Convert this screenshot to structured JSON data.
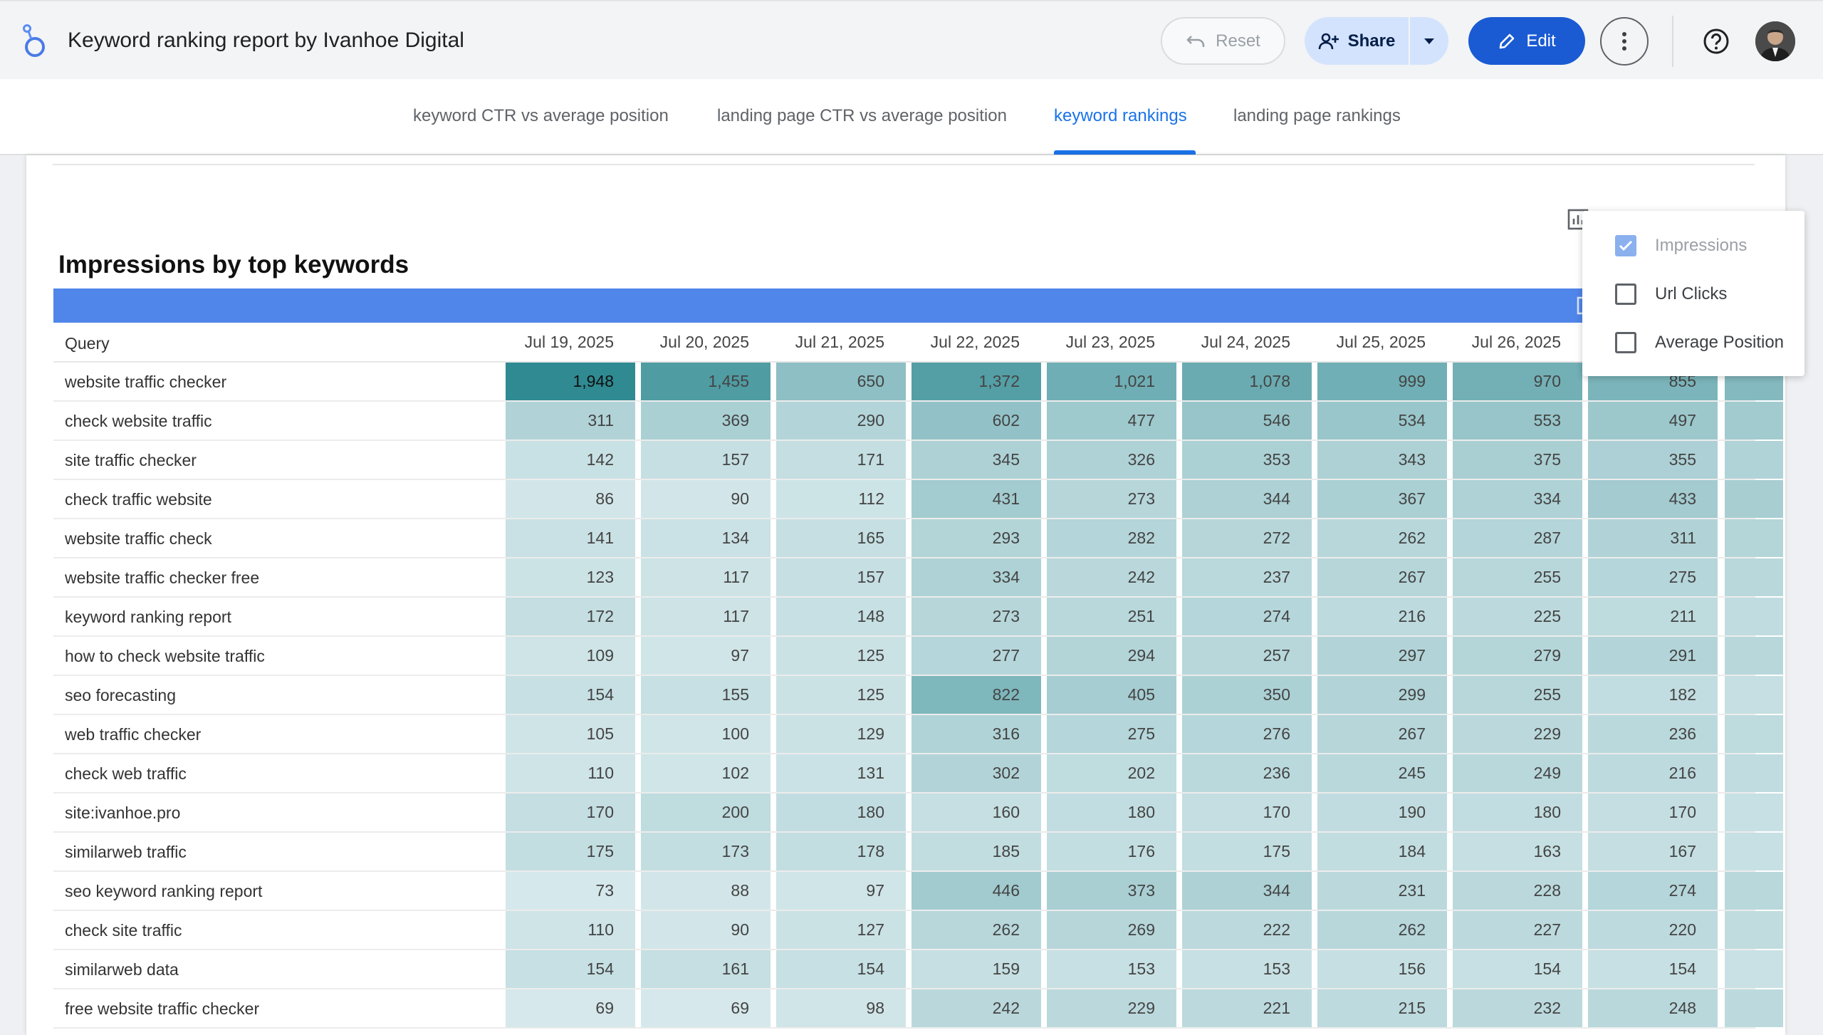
{
  "app": {
    "title": "Keyword ranking report by Ivanhoe Digital"
  },
  "toolbar": {
    "reset_label": "Reset",
    "share_label": "Share",
    "edit_label": "Edit"
  },
  "tabs": [
    {
      "label": "keyword CTR vs average position",
      "active": false
    },
    {
      "label": "landing page CTR vs average position",
      "active": false
    },
    {
      "label": "keyword rankings",
      "active": true
    },
    {
      "label": "landing page rankings",
      "active": false
    }
  ],
  "report": {
    "title": "Impressions by top keywords",
    "query_header": "Query",
    "dates": [
      "Jul 19, 2025",
      "Jul 20, 2025",
      "Jul 21, 2025",
      "Jul 22, 2025",
      "Jul 23, 2025",
      "Jul 24, 2025",
      "Jul 25, 2025",
      "Jul 26, 2025"
    ],
    "rows": [
      {
        "query": "website traffic checker",
        "values": [
          "1,948",
          "1,455",
          "650",
          "1,372",
          "1,021",
          "1,078",
          "999",
          "970",
          "855"
        ]
      },
      {
        "query": "check website traffic",
        "values": [
          "311",
          "369",
          "290",
          "602",
          "477",
          "546",
          "534",
          "553",
          "497"
        ]
      },
      {
        "query": "site traffic checker",
        "values": [
          "142",
          "157",
          "171",
          "345",
          "326",
          "353",
          "343",
          "375",
          "355"
        ]
      },
      {
        "query": "check traffic website",
        "values": [
          "86",
          "90",
          "112",
          "431",
          "273",
          "344",
          "367",
          "334",
          "433"
        ]
      },
      {
        "query": "website traffic check",
        "values": [
          "141",
          "134",
          "165",
          "293",
          "282",
          "272",
          "262",
          "287",
          "311"
        ]
      },
      {
        "query": "website traffic checker free",
        "values": [
          "123",
          "117",
          "157",
          "334",
          "242",
          "237",
          "267",
          "255",
          "275"
        ]
      },
      {
        "query": "keyword ranking report",
        "values": [
          "172",
          "117",
          "148",
          "273",
          "251",
          "274",
          "216",
          "225",
          "211"
        ]
      },
      {
        "query": "how to check website traffic",
        "values": [
          "109",
          "97",
          "125",
          "277",
          "294",
          "257",
          "297",
          "279",
          "291"
        ]
      },
      {
        "query": "seo forecasting",
        "values": [
          "154",
          "155",
          "125",
          "822",
          "405",
          "350",
          "299",
          "255",
          "182"
        ]
      },
      {
        "query": "web traffic checker",
        "values": [
          "105",
          "100",
          "129",
          "316",
          "275",
          "276",
          "267",
          "229",
          "236"
        ]
      },
      {
        "query": "check web traffic",
        "values": [
          "110",
          "102",
          "131",
          "302",
          "202",
          "236",
          "245",
          "249",
          "216"
        ]
      },
      {
        "query": "site:ivanhoe.pro",
        "values": [
          "170",
          "200",
          "180",
          "160",
          "180",
          "170",
          "190",
          "180",
          "170"
        ]
      },
      {
        "query": "similarweb traffic",
        "values": [
          "175",
          "173",
          "178",
          "185",
          "176",
          "175",
          "184",
          "163",
          "167"
        ]
      },
      {
        "query": "seo keyword ranking report",
        "values": [
          "73",
          "88",
          "97",
          "446",
          "373",
          "344",
          "231",
          "228",
          "274"
        ]
      },
      {
        "query": "check site traffic",
        "values": [
          "110",
          "90",
          "127",
          "262",
          "269",
          "222",
          "262",
          "227",
          "220"
        ]
      },
      {
        "query": "similarweb data",
        "values": [
          "154",
          "161",
          "154",
          "159",
          "153",
          "153",
          "156",
          "154",
          "154"
        ]
      },
      {
        "query": "free website traffic checker",
        "values": [
          "69",
          "69",
          "98",
          "242",
          "229",
          "221",
          "215",
          "232",
          "248"
        ]
      }
    ]
  },
  "metric_popup": {
    "options": [
      {
        "label": "Impressions",
        "checked": true,
        "disabled": true
      },
      {
        "label": "Url Clicks",
        "checked": false,
        "disabled": false
      },
      {
        "label": "Average Position",
        "checked": false,
        "disabled": false
      }
    ]
  },
  "colors": {
    "accent": "#1a5bd3",
    "tab_active": "#1a73e8",
    "table_header_bar": "#5085ea",
    "heat_max": "#2f8a92",
    "heat_min": "#eef6f8"
  }
}
